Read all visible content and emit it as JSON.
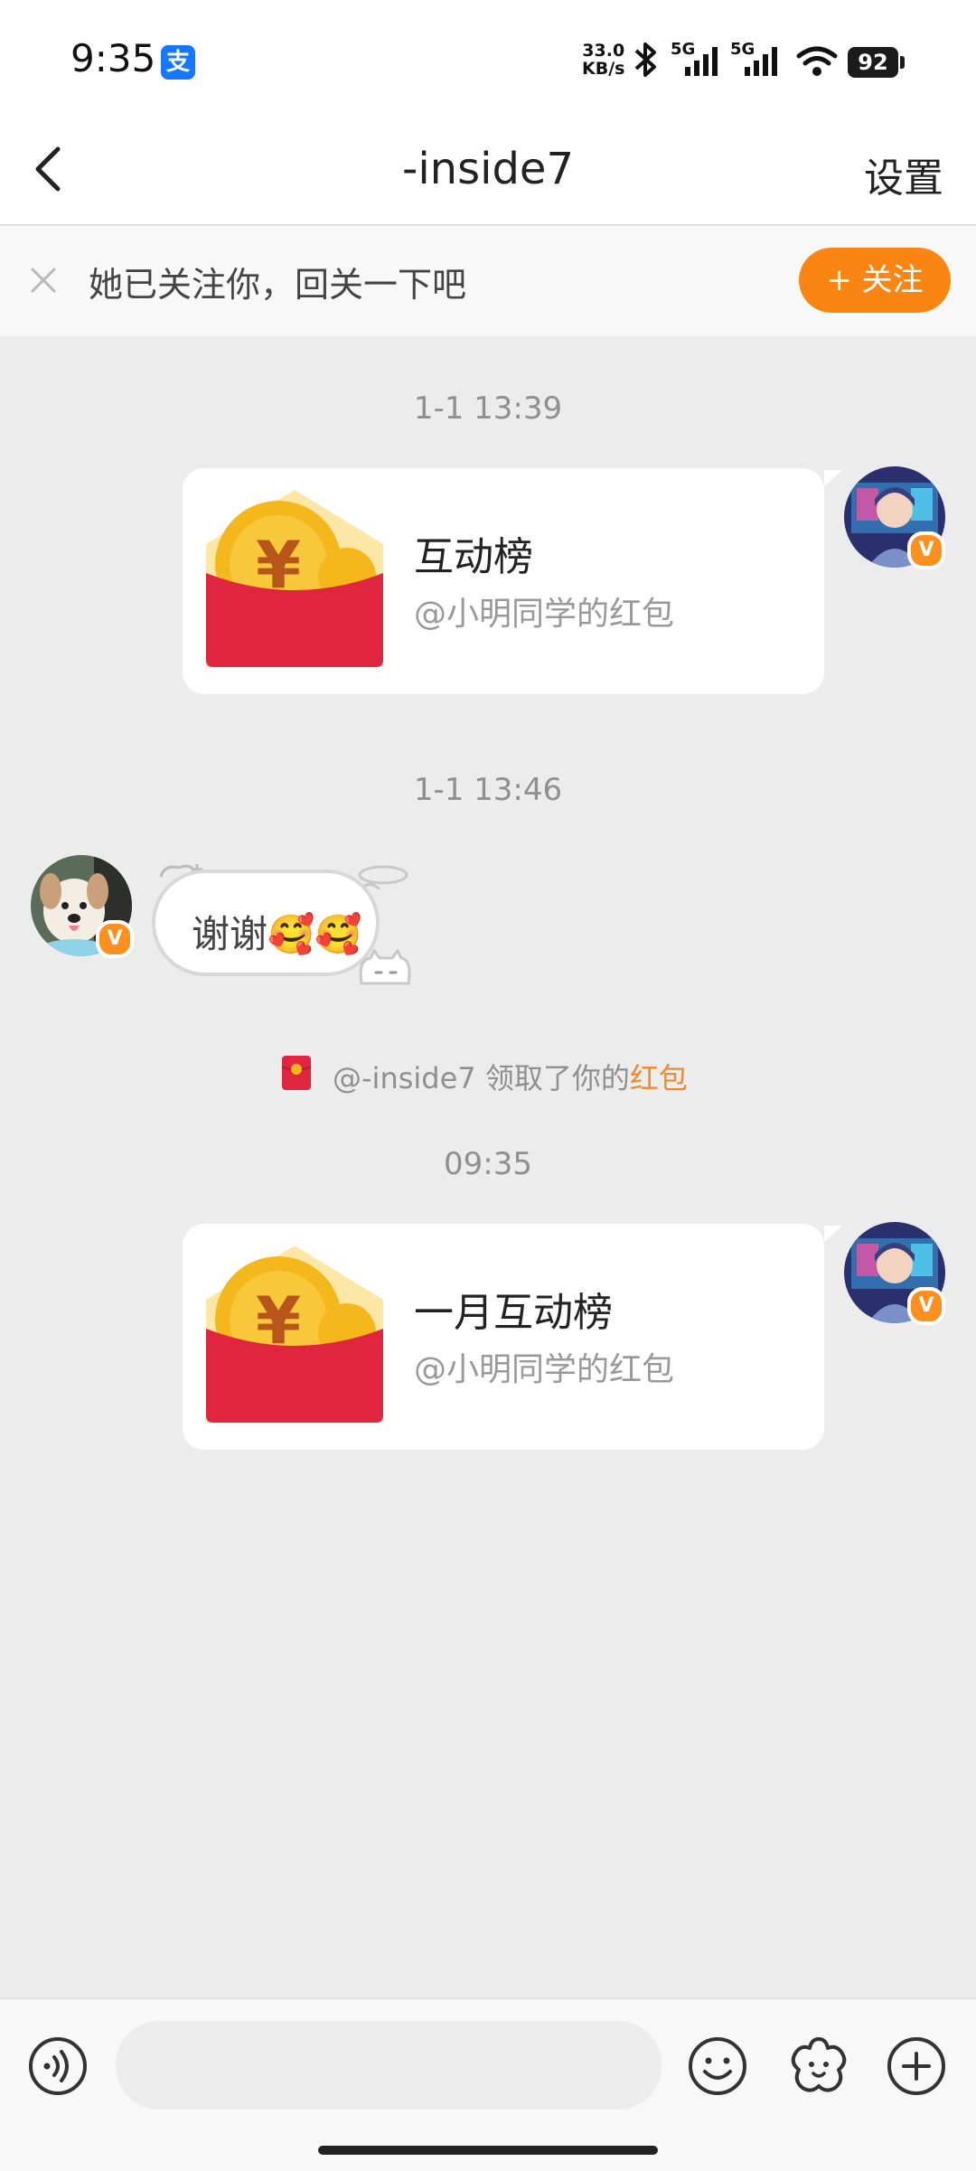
{
  "status_bar": {
    "time": "9:35",
    "app_icon_label": "支",
    "net_speed_value": "33.0",
    "net_speed_unit": "KB/s",
    "signal_1_label": "5G",
    "signal_2_label": "5G",
    "battery": "92"
  },
  "header": {
    "title": "-inside7",
    "settings_label": "设置",
    "back_icon": "chevron-left-icon"
  },
  "follow_banner": {
    "text": "她已关注你，回关一下吧",
    "button_label": "+ 关注"
  },
  "messages": [
    {
      "timestamp": "1-1 13:39",
      "type": "red_packet",
      "title": "互动榜",
      "subtitle": "@小明同学的红包"
    },
    {
      "timestamp": "1-1 13:46",
      "type": "text",
      "text": "谢谢🥰🥰"
    },
    {
      "type": "system",
      "prefix": "@-inside7 领取了你的",
      "link": "红包"
    },
    {
      "timestamp": "09:35",
      "type": "red_packet",
      "title": "一月互动榜",
      "subtitle": "@小明同学的红包"
    }
  ],
  "avatar_badge": "V",
  "bottom_bar": {
    "input_placeholder": "",
    "icons": [
      "voice-icon",
      "emoji-icon",
      "sticker-icon",
      "plus-icon"
    ]
  },
  "colors": {
    "accent": "#fa8512",
    "red_packet": "#e0263f",
    "coin": "#f5b81c",
    "background": "#ececec"
  }
}
